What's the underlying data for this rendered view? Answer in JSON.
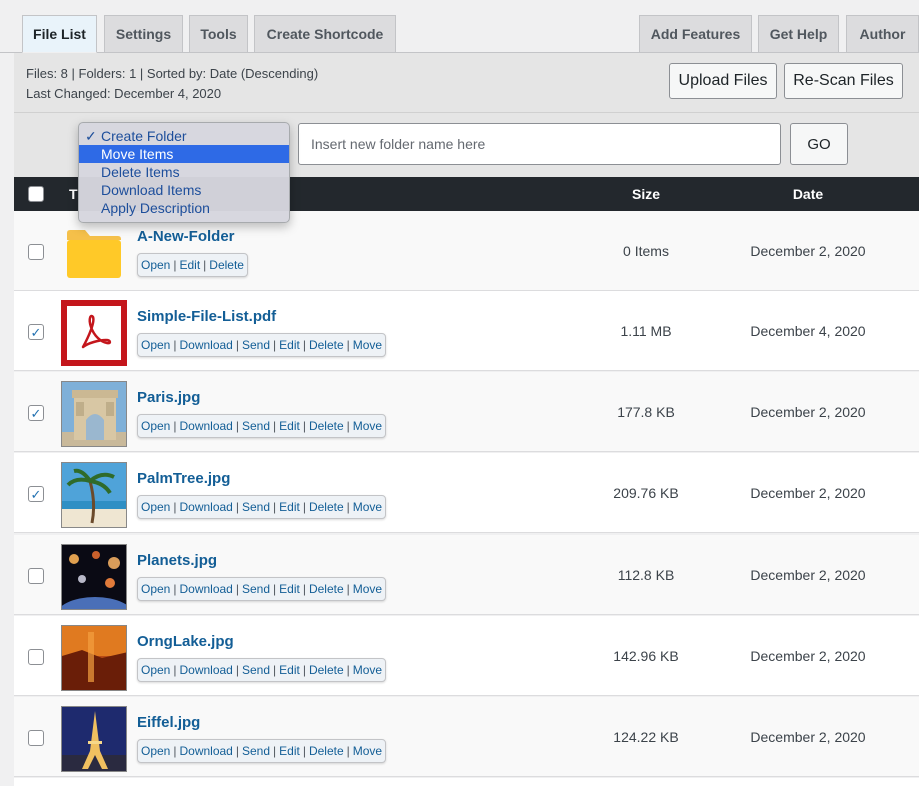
{
  "tabs_left": [
    {
      "label": "File List",
      "active": true
    },
    {
      "label": "Settings",
      "active": false
    },
    {
      "label": "Tools",
      "active": false
    },
    {
      "label": "Create Shortcode",
      "active": false
    }
  ],
  "tabs_right": [
    {
      "label": "Add Features"
    },
    {
      "label": "Get Help"
    },
    {
      "label": "Author"
    }
  ],
  "info": {
    "line1": "Files: 8 | Folders: 1 | Sorted by: Date (Descending)",
    "line2": "Last Changed: December 4, 2020",
    "upload_label": "Upload Files",
    "rescan_label": "Re-Scan Files"
  },
  "bulk": {
    "options": [
      "Create Folder",
      "Move Items",
      "Delete Items",
      "Download Items",
      "Apply Description"
    ],
    "selected": "Create Folder",
    "highlighted": "Move Items",
    "checkmark": "✓",
    "folder_placeholder": "Insert new folder name here",
    "go_label": "GO"
  },
  "table": {
    "header": {
      "title_partial": "T",
      "size": "Size",
      "date": "Date"
    },
    "rows": [
      {
        "name": "A-New-Folder",
        "type": "folder",
        "actions": [
          "Open",
          "Edit",
          "Delete"
        ],
        "size": "0 Items",
        "date": "December 2, 2020",
        "checked": false
      },
      {
        "name": "Simple-File-List.pdf",
        "type": "pdf",
        "actions": [
          "Open",
          "Download",
          "Send",
          "Edit",
          "Delete",
          "Move"
        ],
        "size": "1.11 MB",
        "date": "December 4, 2020",
        "checked": true
      },
      {
        "name": "Paris.jpg",
        "type": "image",
        "actions": [
          "Open",
          "Download",
          "Send",
          "Edit",
          "Delete",
          "Move"
        ],
        "size": "177.8 KB",
        "date": "December 2, 2020",
        "checked": true
      },
      {
        "name": "PalmTree.jpg",
        "type": "image",
        "actions": [
          "Open",
          "Download",
          "Send",
          "Edit",
          "Delete",
          "Move"
        ],
        "size": "209.76 KB",
        "date": "December 2, 2020",
        "checked": true
      },
      {
        "name": "Planets.jpg",
        "type": "image",
        "actions": [
          "Open",
          "Download",
          "Send",
          "Edit",
          "Delete",
          "Move"
        ],
        "size": "112.8 KB",
        "date": "December 2, 2020",
        "checked": false
      },
      {
        "name": "OrngLake.jpg",
        "type": "image",
        "actions": [
          "Open",
          "Download",
          "Send",
          "Edit",
          "Delete",
          "Move"
        ],
        "size": "142.96 KB",
        "date": "December 2, 2020",
        "checked": false
      },
      {
        "name": "Eiffel.jpg",
        "type": "image",
        "actions": [
          "Open",
          "Download",
          "Send",
          "Edit",
          "Delete",
          "Move"
        ],
        "size": "124.22 KB",
        "date": "December 2, 2020",
        "checked": false
      }
    ]
  },
  "colors": {
    "accent": "#135e96",
    "header_bg": "#23282d",
    "menu_highlight": "#2e6ae6"
  },
  "icons": {
    "folder": "folder-icon",
    "pdf": "pdf-icon",
    "check": "checkmark-icon"
  }
}
